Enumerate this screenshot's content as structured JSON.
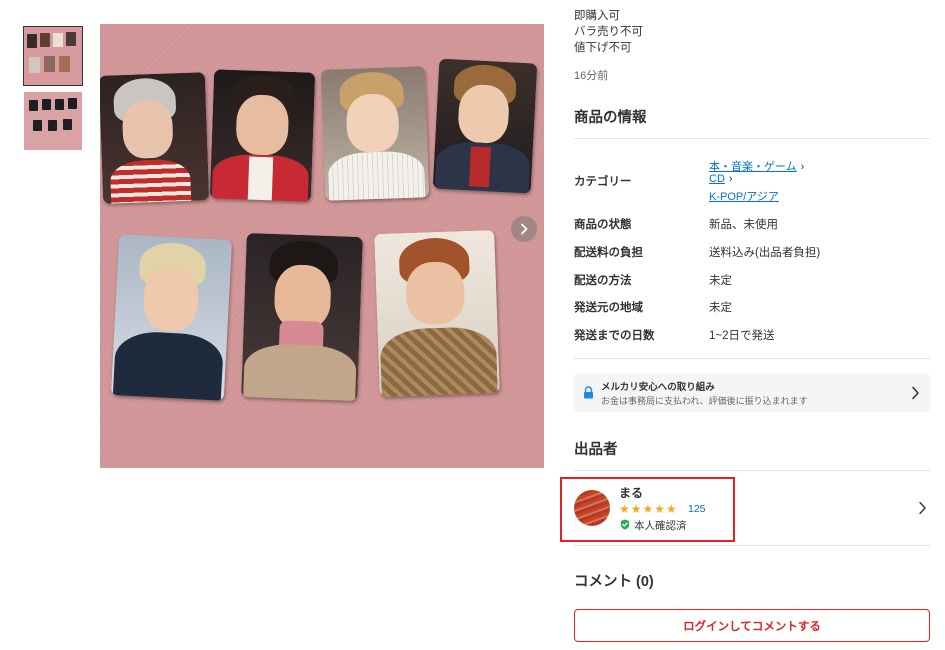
{
  "item_notes": [
    "即購入可",
    "バラ売り不可",
    "値下げ不可"
  ],
  "posted_time": "16分前",
  "product_info": {
    "title": "商品の情報",
    "category_label": "カテゴリー",
    "categories": [
      "本・音楽・ゲーム",
      "CD",
      "K-POP/アジア"
    ],
    "rows": [
      {
        "label": "商品の状態",
        "value": "新品、未使用"
      },
      {
        "label": "配送料の負担",
        "value": "送料込み(出品者負担)"
      },
      {
        "label": "配送の方法",
        "value": "未定"
      },
      {
        "label": "発送元の地域",
        "value": "未定"
      },
      {
        "label": "発送までの日数",
        "value": "1~2日で発送"
      }
    ]
  },
  "safety": {
    "title": "メルカリ安心への取り組み",
    "subtitle": "お金は事務局に支払われ、評価後に振り込まれます"
  },
  "seller": {
    "section_title": "出品者",
    "name": "まる",
    "stars": "★★★★★",
    "rating_value": 5,
    "review_count": "125",
    "verified_label": "本人確認済"
  },
  "comments": {
    "title": "コメント",
    "count": "(0)",
    "button_label": "ログインしてコメントする"
  },
  "colors": {
    "accent_red": "#e52222",
    "link_blue": "#0073cc",
    "star": "#f2a91e",
    "verified_green": "#2bab5c"
  },
  "icons": {
    "next": "chevron-right-icon",
    "safety": "lock-icon",
    "verified": "shield-check-icon"
  }
}
